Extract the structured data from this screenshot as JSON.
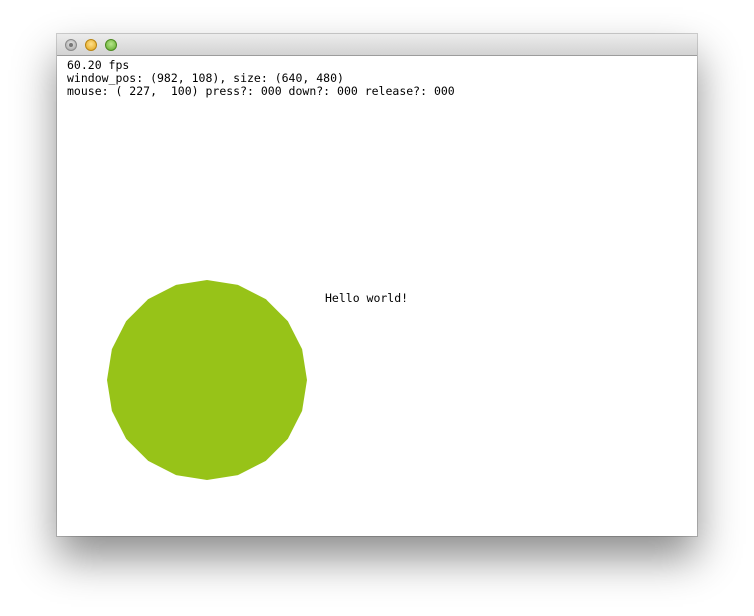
{
  "window": {
    "title": ""
  },
  "overlay": {
    "fps": "60.20 fps",
    "window_info": "window_pos: (982, 108), size: (640, 480)",
    "mouse_info": "mouse: ( 227,  100) press?: 000 down?: 000 release?: 000"
  },
  "canvas": {
    "text": "Hello world!",
    "circle_color": "#97c318"
  },
  "icons": {
    "close": "close-button-icon",
    "minimize": "minimize-button-icon",
    "zoom": "zoom-button-icon"
  }
}
